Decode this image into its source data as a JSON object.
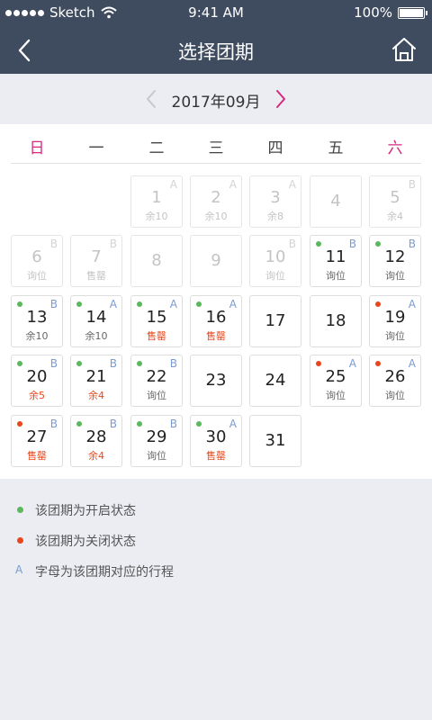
{
  "status_bar": {
    "carrier": "Sketch",
    "time": "9:41 AM",
    "battery": "100%"
  },
  "nav": {
    "title": "选择团期",
    "back_icon": "chevron-left-icon",
    "home_icon": "home-icon"
  },
  "month": {
    "label": "2017年09月"
  },
  "weekdays": [
    "日",
    "一",
    "二",
    "三",
    "四",
    "五",
    "六"
  ],
  "colors": {
    "header_bg": "#3f4c5f",
    "weekend": "#d9287f",
    "open_dot": "#5cb85c",
    "closed_dot": "#e8471c",
    "letter": "#7b9bd0"
  },
  "days": [
    {
      "day": "1",
      "letter": "A",
      "sub": "余10",
      "dot": "",
      "state": "past",
      "sub_red": false
    },
    {
      "day": "2",
      "letter": "A",
      "sub": "余10",
      "dot": "",
      "state": "past",
      "sub_red": false
    },
    {
      "day": "3",
      "letter": "A",
      "sub": "余8",
      "dot": "",
      "state": "past",
      "sub_red": false
    },
    {
      "day": "4",
      "letter": "",
      "sub": "",
      "dot": "",
      "state": "past",
      "sub_red": false
    },
    {
      "day": "5",
      "letter": "B",
      "sub": "余4",
      "dot": "",
      "state": "past",
      "sub_red": false
    },
    {
      "day": "6",
      "letter": "B",
      "sub": "询位",
      "dot": "",
      "state": "past",
      "sub_red": false
    },
    {
      "day": "7",
      "letter": "B",
      "sub": "售罄",
      "dot": "",
      "state": "past",
      "sub_red": false
    },
    {
      "day": "8",
      "letter": "",
      "sub": "",
      "dot": "",
      "state": "past",
      "sub_red": false
    },
    {
      "day": "9",
      "letter": "",
      "sub": "",
      "dot": "",
      "state": "past",
      "sub_red": false
    },
    {
      "day": "10",
      "letter": "B",
      "sub": "询位",
      "dot": "",
      "state": "past",
      "sub_red": false
    },
    {
      "day": "11",
      "letter": "B",
      "sub": "询位",
      "dot": "green",
      "state": "active",
      "sub_red": false
    },
    {
      "day": "12",
      "letter": "B",
      "sub": "询位",
      "dot": "green",
      "state": "active",
      "sub_red": false
    },
    {
      "day": "13",
      "letter": "B",
      "sub": "余10",
      "dot": "green",
      "state": "active",
      "sub_red": false
    },
    {
      "day": "14",
      "letter": "A",
      "sub": "余10",
      "dot": "green",
      "state": "active",
      "sub_red": false
    },
    {
      "day": "15",
      "letter": "A",
      "sub": "售罄",
      "dot": "green",
      "state": "active",
      "sub_red": true
    },
    {
      "day": "16",
      "letter": "A",
      "sub": "售罄",
      "dot": "green",
      "state": "active",
      "sub_red": true
    },
    {
      "day": "17",
      "letter": "",
      "sub": "",
      "dot": "",
      "state": "active",
      "sub_red": false
    },
    {
      "day": "18",
      "letter": "",
      "sub": "",
      "dot": "",
      "state": "active",
      "sub_red": false
    },
    {
      "day": "19",
      "letter": "A",
      "sub": "询位",
      "dot": "red",
      "state": "active",
      "sub_red": false
    },
    {
      "day": "20",
      "letter": "B",
      "sub": "余5",
      "dot": "green",
      "state": "active",
      "sub_red": true
    },
    {
      "day": "21",
      "letter": "B",
      "sub": "余4",
      "dot": "green",
      "state": "active",
      "sub_red": true
    },
    {
      "day": "22",
      "letter": "B",
      "sub": "询位",
      "dot": "green",
      "state": "active",
      "sub_red": false
    },
    {
      "day": "23",
      "letter": "",
      "sub": "",
      "dot": "",
      "state": "active",
      "sub_red": false
    },
    {
      "day": "24",
      "letter": "",
      "sub": "",
      "dot": "",
      "state": "active",
      "sub_red": false
    },
    {
      "day": "25",
      "letter": "A",
      "sub": "询位",
      "dot": "red",
      "state": "active",
      "sub_red": false
    },
    {
      "day": "26",
      "letter": "A",
      "sub": "询位",
      "dot": "red",
      "state": "active",
      "sub_red": false
    },
    {
      "day": "27",
      "letter": "B",
      "sub": "售罄",
      "dot": "red",
      "state": "active",
      "sub_red": true
    },
    {
      "day": "28",
      "letter": "B",
      "sub": "余4",
      "dot": "green",
      "state": "active",
      "sub_red": true
    },
    {
      "day": "29",
      "letter": "B",
      "sub": "询位",
      "dot": "green",
      "state": "active",
      "sub_red": false
    },
    {
      "day": "30",
      "letter": "A",
      "sub": "售罄",
      "dot": "green",
      "state": "active",
      "sub_red": true
    },
    {
      "day": "31",
      "letter": "",
      "sub": "",
      "dot": "",
      "state": "active",
      "sub_red": false
    }
  ],
  "legend": [
    {
      "marker": "dot",
      "color": "green",
      "text": "该团期为开启状态"
    },
    {
      "marker": "dot",
      "color": "red",
      "text": "该团期为关闭状态"
    },
    {
      "marker": "letter",
      "letter": "A",
      "text": "字母为该团期对应的行程"
    }
  ]
}
